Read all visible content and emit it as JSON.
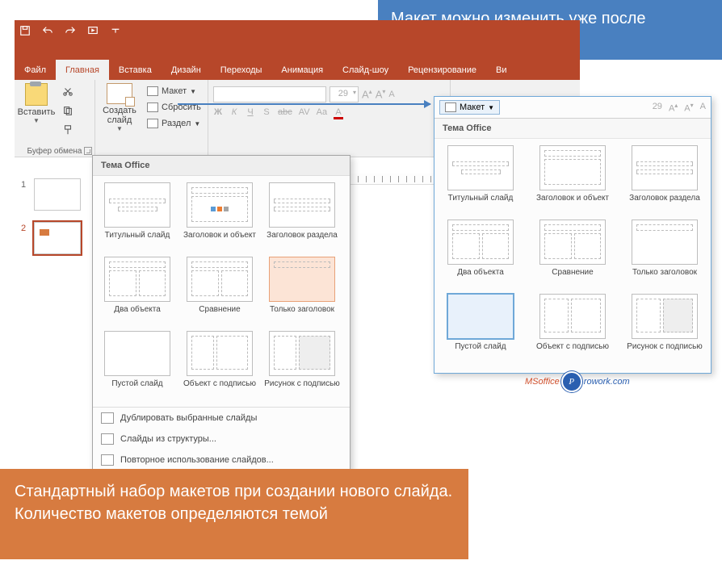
{
  "callouts": {
    "blue": "Макет можно изменить уже после создания слайда",
    "orange": "Стандартный набор макетов при создании нового слайда. Количество макетов определяются темой"
  },
  "qat": {
    "save": "save-icon",
    "undo": "undo-icon",
    "redo": "redo-icon",
    "start": "start-from-beginning-icon"
  },
  "tabs": {
    "file": "Файл",
    "home": "Главная",
    "insert": "Вставка",
    "design": "Дизайн",
    "transitions": "Переходы",
    "animations": "Анимация",
    "slideshow": "Слайд-шоу",
    "review": "Рецензирование",
    "view_partial": "Ви"
  },
  "ribbon": {
    "clipboard": {
      "paste": "Вставить",
      "group_label": "Буфер обмена"
    },
    "slides": {
      "new_slide": "Создать слайд",
      "layout": "Макет",
      "reset": "Сбросить",
      "section": "Раздел"
    },
    "font": {
      "size": "29",
      "buttons": {
        "bold": "Ж",
        "italic": "К",
        "underline": "Ч",
        "shadow": "S",
        "strike": "abc",
        "spacing": "AV",
        "case": "Aa",
        "clear": "A"
      }
    }
  },
  "thumbs": {
    "n1": "1",
    "n2": "2"
  },
  "gallery_left": {
    "header": "Тема Office",
    "layouts": {
      "title": "Титульный слайд",
      "title_content": "Заголовок и объект",
      "section": "Заголовок раздела",
      "two_content": "Два объекта",
      "comparison": "Сравнение",
      "title_only": "Только заголовок",
      "blank": "Пустой слайд",
      "content_caption": "Объект с подписью",
      "picture_caption": "Рисунок с подписью"
    },
    "footer": {
      "duplicate": "Дублировать выбранные слайды",
      "outline": "Слайды из структуры...",
      "reuse": "Повторное использование слайдов..."
    }
  },
  "gallery_right": {
    "layout_btn": "Макет",
    "header": "Тема Office",
    "size": "29",
    "layouts": {
      "title": "Титульный слайд",
      "title_content": "Заголовок и объект",
      "section": "Заголовок раздела",
      "two_content": "Два объекта",
      "comparison": "Сравнение",
      "title_only": "Только заголовок",
      "blank": "Пустой слайд",
      "content_caption": "Объект с подписью",
      "picture_caption": "Рисунок с подписью"
    }
  },
  "watermark": {
    "pre": "MSoffice",
    "badge": "P",
    "post": "rowork.com"
  }
}
